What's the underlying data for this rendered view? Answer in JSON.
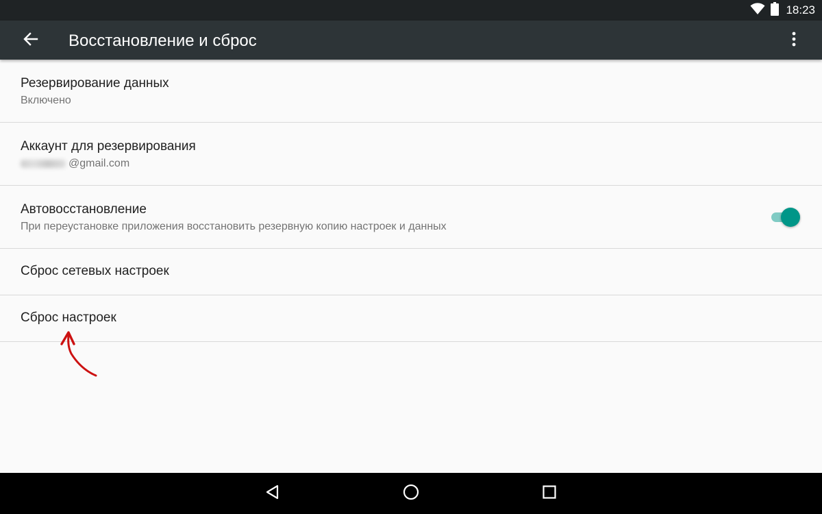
{
  "status_bar": {
    "time": "18:23",
    "icons": [
      "wifi-icon",
      "battery-icon"
    ]
  },
  "toolbar": {
    "title": "Восстановление и сброс",
    "back_icon": "arrow-back-icon",
    "menu_icon": "more-vert-icon"
  },
  "settings": {
    "backup_data": {
      "title": "Резервирование данных",
      "summary": "Включено"
    },
    "backup_account": {
      "title": "Аккаунт для резервирования",
      "email_suffix": "@gmail.com"
    },
    "auto_restore": {
      "title": "Автовосстановление",
      "summary": "При переустановке приложения восстановить резервную копию настроек и данных",
      "enabled": true
    },
    "network_reset": {
      "title": "Сброс сетевых настроек"
    },
    "factory_reset": {
      "title": "Сброс настроек"
    }
  },
  "annotation": {
    "icon": "red-arrow-icon"
  },
  "navigation_bar": {
    "icons": [
      "back-triangle-icon",
      "home-circle-icon",
      "recents-square-icon"
    ]
  },
  "colors": {
    "status_bar": "#1f2325",
    "toolbar": "#2d3437",
    "background": "#fafafa",
    "accent": "#009688",
    "accent_track": "#80cbc4",
    "annotation": "#cc1111"
  }
}
